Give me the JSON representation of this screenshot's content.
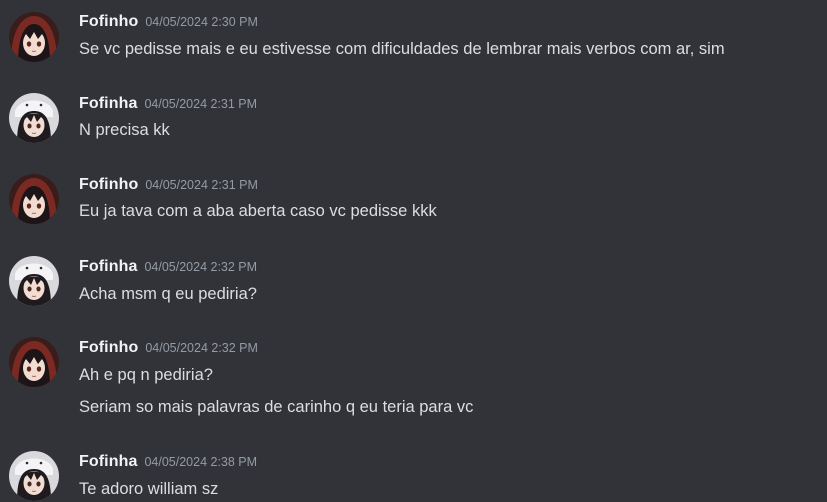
{
  "messages": [
    {
      "author": "Fofinho",
      "timestamp": "04/05/2024 2:30 PM",
      "avatar": "hooded-girl-avatar",
      "lines": [
        "Se vc pedisse mais e eu estivesse com dificuldades de lembrar mais verbos com ar, sim"
      ]
    },
    {
      "author": "Fofinha",
      "timestamp": "04/05/2024 2:31 PM",
      "avatar": "bunny-hat-girl-avatar",
      "lines": [
        "N precisa kk"
      ]
    },
    {
      "author": "Fofinho",
      "timestamp": "04/05/2024 2:31 PM",
      "avatar": "hooded-girl-avatar",
      "lines": [
        "Eu ja tava com a aba aberta caso vc pedisse kkk"
      ]
    },
    {
      "author": "Fofinha",
      "timestamp": "04/05/2024 2:32 PM",
      "avatar": "bunny-hat-girl-avatar",
      "lines": [
        "Acha msm q eu pediria?"
      ]
    },
    {
      "author": "Fofinho",
      "timestamp": "04/05/2024 2:32 PM",
      "avatar": "hooded-girl-avatar",
      "lines": [
        "Ah e pq n pediria?",
        "Seriam so mais palavras de carinho q eu teria para vc"
      ]
    },
    {
      "author": "Fofinha",
      "timestamp": "04/05/2024 2:38 PM",
      "avatar": "bunny-hat-girl-avatar",
      "lines": [
        "Te adoro william sz"
      ]
    }
  ],
  "colors": {
    "background": "#323339",
    "author": "#f2f3f5",
    "timestamp": "#949ba4",
    "text": "#dbdee1"
  }
}
